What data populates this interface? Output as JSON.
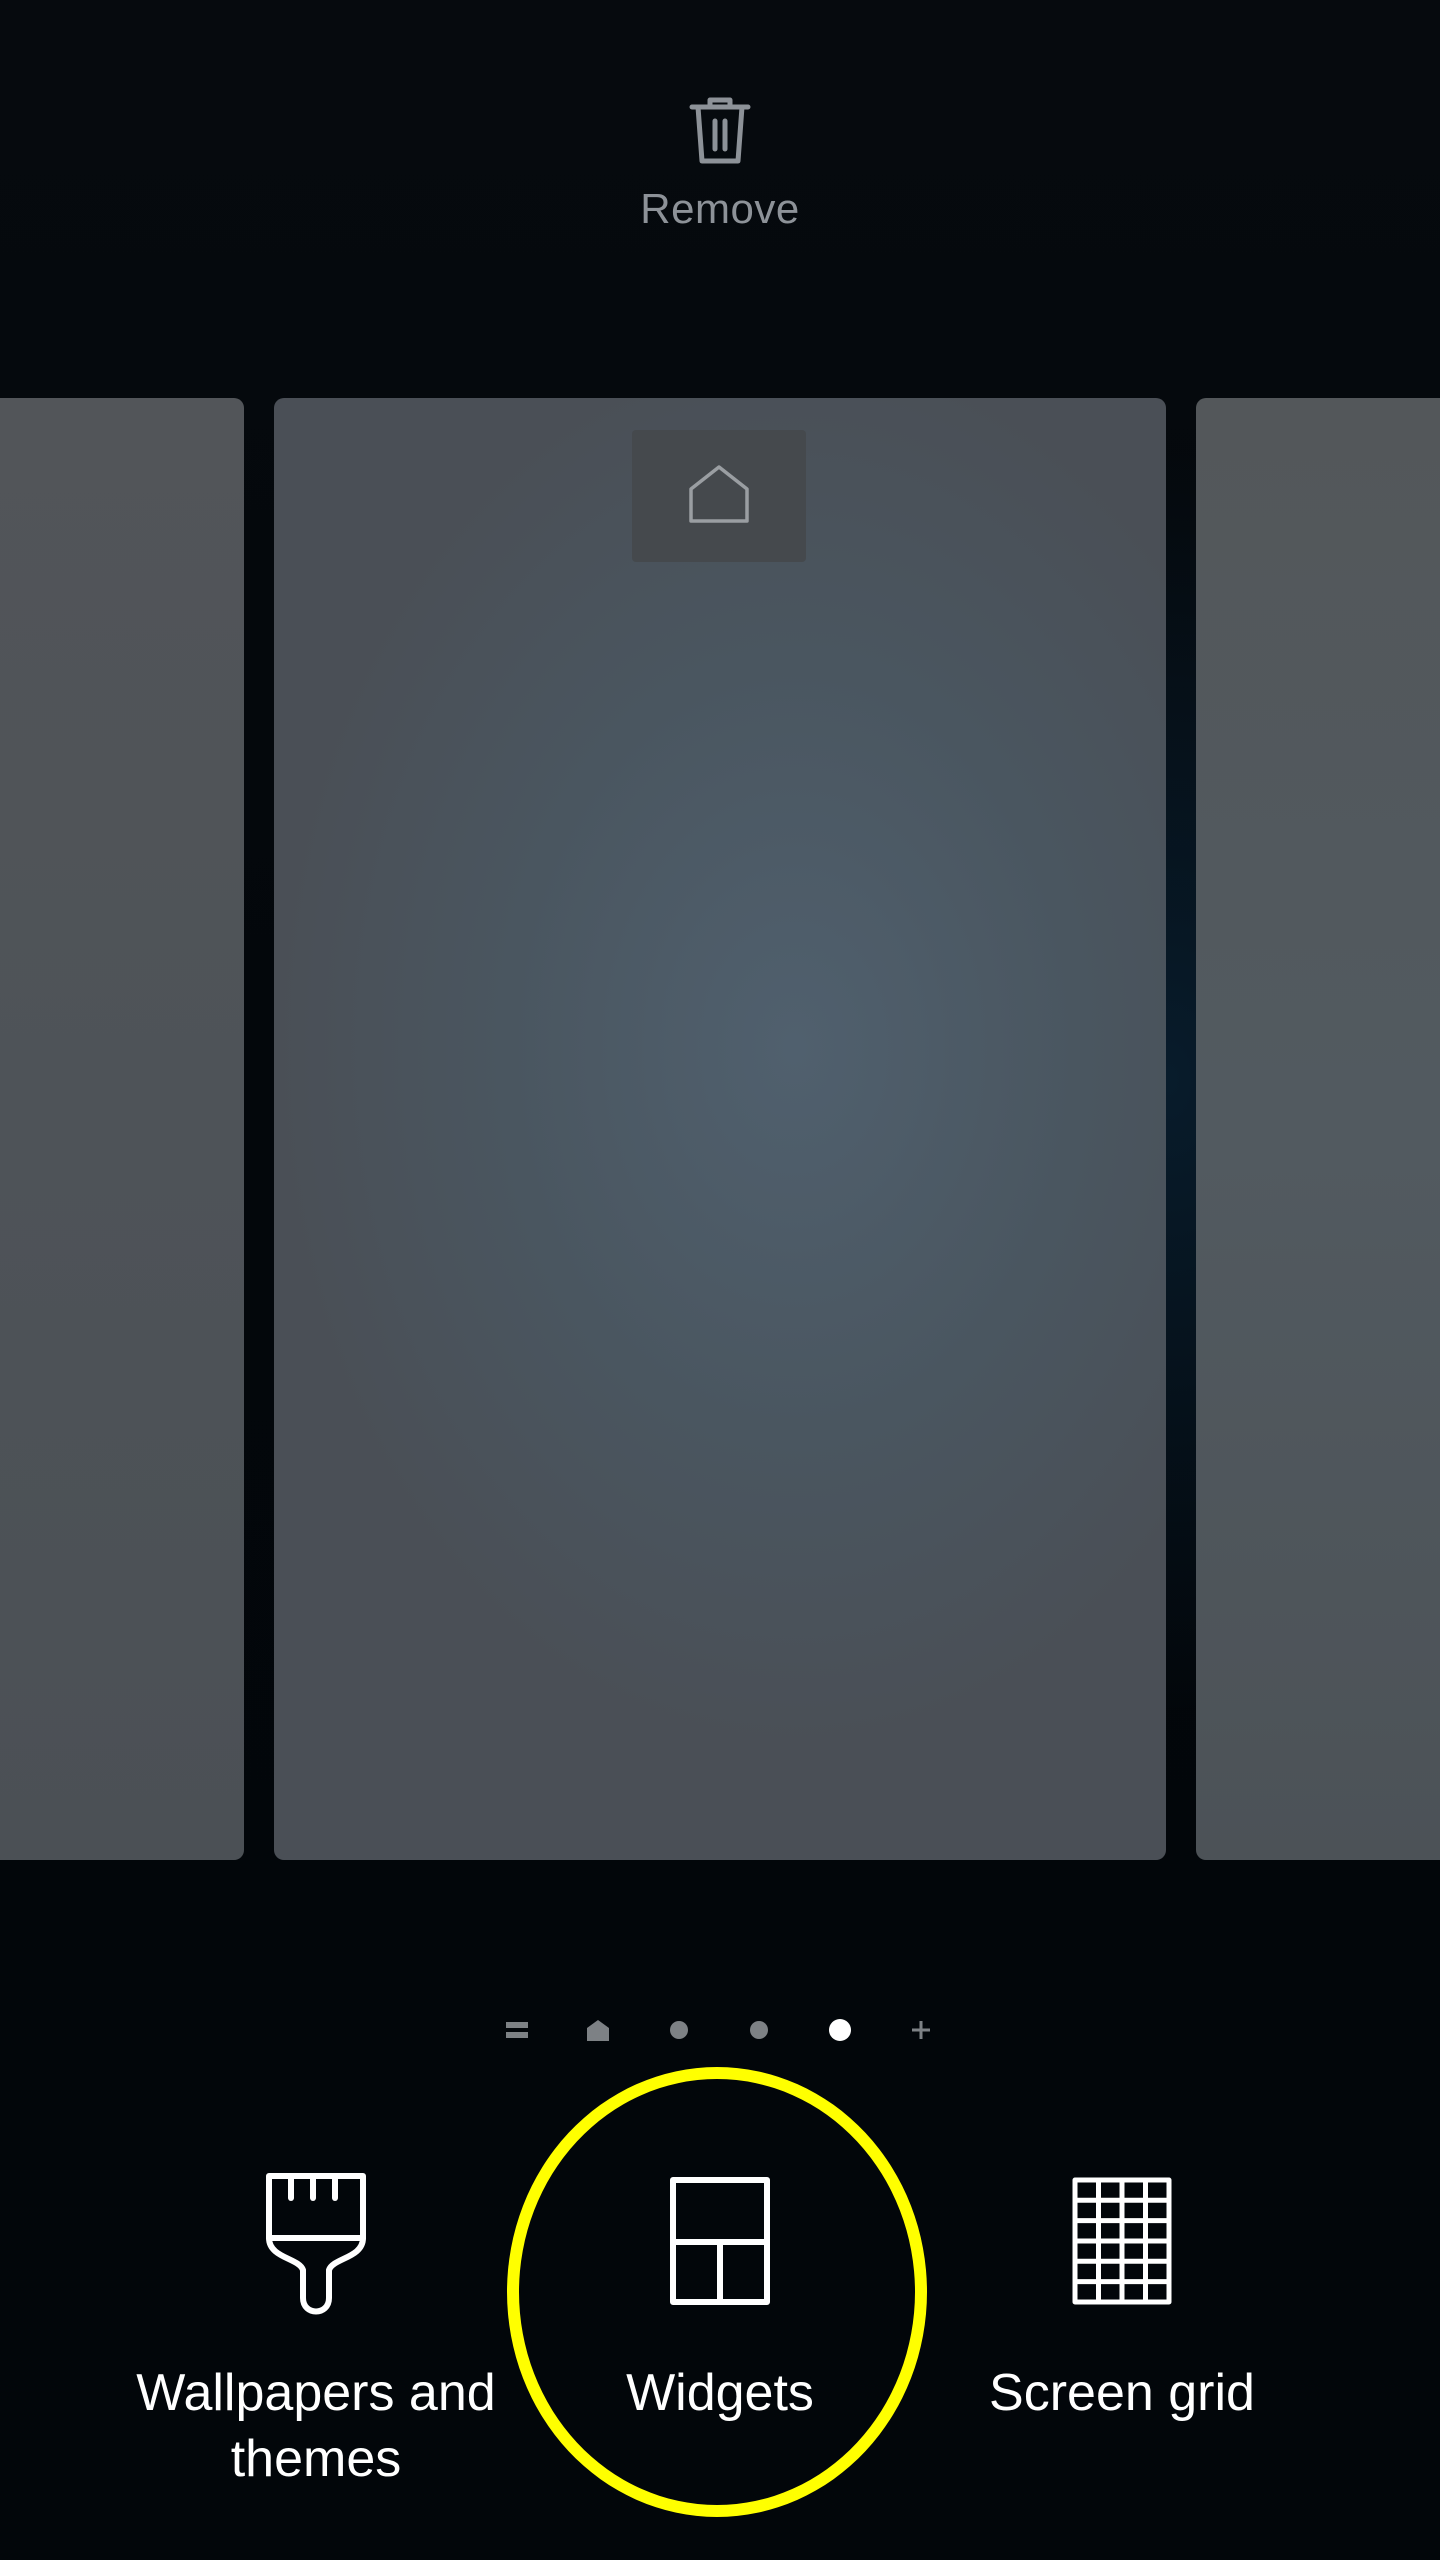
{
  "top": {
    "remove_label": "Remove",
    "remove_icon": "trash-icon"
  },
  "pages": {
    "home_icon": "home-outline-icon",
    "count_visible": 3
  },
  "indicator": {
    "items": [
      {
        "type": "apps-list-icon"
      },
      {
        "type": "home-icon"
      },
      {
        "type": "dot"
      },
      {
        "type": "dot"
      },
      {
        "type": "dot",
        "active": true
      },
      {
        "type": "plus-icon"
      }
    ]
  },
  "options": {
    "wallpapers_label_line1": "Wallpapers and",
    "wallpapers_label_line2": "themes",
    "widgets_label": "Widgets",
    "grid_label": "Screen grid"
  },
  "colors": {
    "highlight": "#ffff00",
    "background": "#03080d",
    "page": "#4e5860"
  }
}
